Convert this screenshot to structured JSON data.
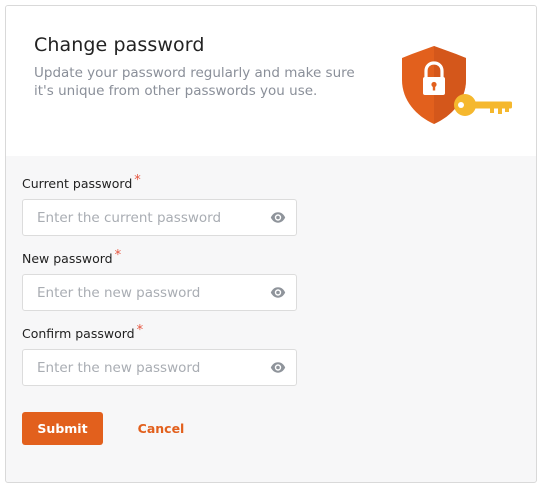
{
  "header": {
    "title": "Change password",
    "subtitle": "Update your password regularly and make sure it's unique from other passwords you use.",
    "illustration_icon": "shield-lock-key-illustration"
  },
  "form": {
    "current_password": {
      "label": "Current password",
      "required_mark": "*",
      "placeholder": "Enter the current password",
      "value": ""
    },
    "new_password": {
      "label": "New password",
      "required_mark": "*",
      "placeholder": "Enter the new password",
      "value": ""
    },
    "confirm_password": {
      "label": "Confirm password",
      "required_mark": "*",
      "placeholder": "Enter the new password",
      "value": ""
    },
    "toggle_icon": "eye-icon"
  },
  "actions": {
    "submit_label": "Submit",
    "cancel_label": "Cancel"
  },
  "colors": {
    "accent": "#e2601d",
    "required": "#e5533d",
    "key": "#f5b82e",
    "shield": "#e2601d"
  }
}
